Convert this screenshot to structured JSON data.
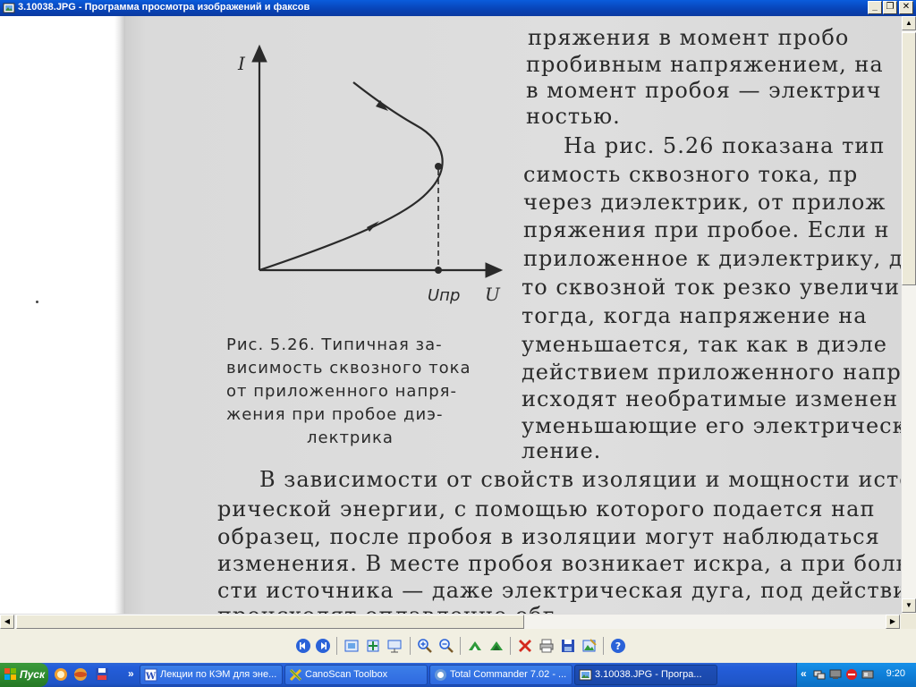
{
  "window": {
    "title": "3.10038.JPG - Программа просмотра изображений и факсов",
    "minimize": "_",
    "maximize": "❐",
    "close": "✕"
  },
  "scan": {
    "graph": {
      "y_axis_label": "I",
      "x_axis_label": "U",
      "x_point_label": "Uпр"
    },
    "caption": [
      "Рис. 5.26. Типичная    за-",
      "висимость сквозного тока",
      "от приложенного    напря-",
      "жения при пробое диэ-",
      "лектрика"
    ],
    "right_column": [
      "пряжения   в   момент  пробо",
      "пробивным  напряжением,   на",
      "в момент   пробоя — электрич",
      "ностью.",
      "На  рис.  5.26  показана  тип",
      "симость   сквозного   тока,   пр",
      "через  диэлектрик,   от  прилож",
      "пряжения  при  пробое.  Если  н",
      "приложенное к диэлектрику, до",
      "то сквозной ток резко увеличи",
      "тогда,   когда    напряжение  на",
      "уменьшается,   так  как  в  диэле",
      "действием  приложенного  напря",
      "исходят  необратимые   изменен",
      "уменьшающие его электрическо",
      "ление."
    ],
    "bottom_lines": [
      "В зависимости от свойств изоляции и мощности источ",
      "рической  энергии,  с  помощью  которого  подается  нап",
      "образец,  после  пробоя  в  изоляции  могут  наблюдаться",
      "изменения.  В месте пробоя возникает искра,  а  при  боль",
      "сти  источника — даже электрическая  дуга,  под действи",
      "происходят  оплавление  обг"
    ]
  },
  "toolbar": {
    "buttons": [
      "previous-image",
      "next-image",
      "best-fit",
      "actual-size",
      "slideshow",
      "zoom-in",
      "zoom-out",
      "rotate-clockwise",
      "rotate-counterclockwise",
      "delete",
      "print",
      "save",
      "open-editor",
      "help"
    ]
  },
  "taskbar": {
    "start_label": "Пуск",
    "more_label": "»",
    "tasks": [
      {
        "label": "Лекции по КЭМ для эне...",
        "icon": "word-icon"
      },
      {
        "label": "CanoScan Toolbox",
        "icon": "canoscan-icon"
      },
      {
        "label": "Total Commander 7.02 - ...",
        "icon": "total-commander-icon"
      },
      {
        "label": "3.10038.JPG - Програ...",
        "icon": "image-viewer-icon"
      }
    ],
    "tray_chevron": "«",
    "clock": "9:20"
  }
}
